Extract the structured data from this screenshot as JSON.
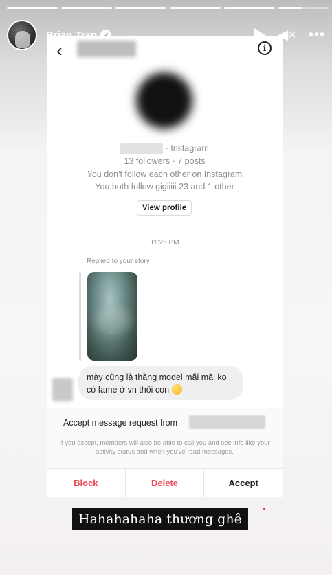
{
  "story": {
    "progress_segments": 6,
    "current_segment_progress": 0.45,
    "username": "Brian Tran",
    "verified_glyph": "✓",
    "icons": [
      "play-icon",
      "mute-icon",
      "more-icon"
    ],
    "mute_glyph": "◀×",
    "more_glyph": "•••",
    "caption": "Hahahahaha thương ghê"
  },
  "dm": {
    "back_glyph": "‹",
    "info_glyph": "i",
    "platform": "· Instagram",
    "stats": "13 followers · 7 posts",
    "follow_status": "You don't follow each other on Instagram",
    "mutual": "You both follow gigiiiii.23 and 1 other",
    "view_profile_label": "View profile",
    "time": "11:25 PM",
    "replied_label": "Replied to your story",
    "message_line1": "mày cũng là thằng model mãi mãi ko",
    "message_line2": "có fame ở vn thôi con",
    "request_label": "Accept message request from",
    "request_note": "If you accept, members will also be able to call you and see info like your activity status and when you've read messages.",
    "actions": {
      "block": "Block",
      "delete": "Delete",
      "accept": "Accept"
    },
    "colors": {
      "destructive": "#ed4956",
      "secondary_text": "#8e8e8e"
    }
  }
}
